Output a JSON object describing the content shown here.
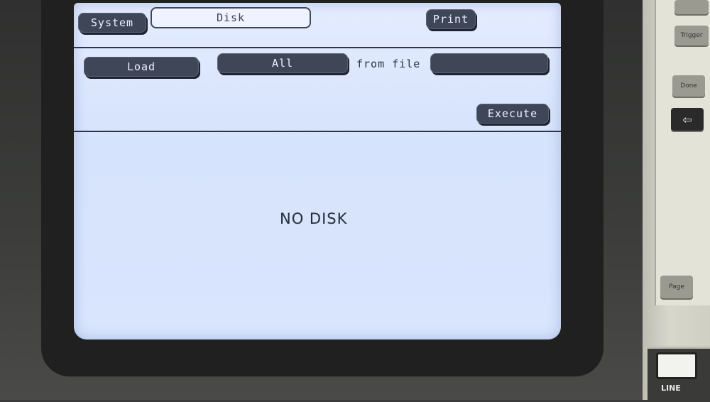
{
  "tabs": {
    "system": "System",
    "disk": "Disk",
    "print": "Print"
  },
  "operation": {
    "load": "Load",
    "all": "All",
    "from_file_label": "from file",
    "file_value": "",
    "execute": "Execute"
  },
  "status": {
    "message": "NO DISK"
  },
  "front_panel": {
    "trigger": "Trigger",
    "done": "Done",
    "page": "Page",
    "line": "LINE"
  }
}
